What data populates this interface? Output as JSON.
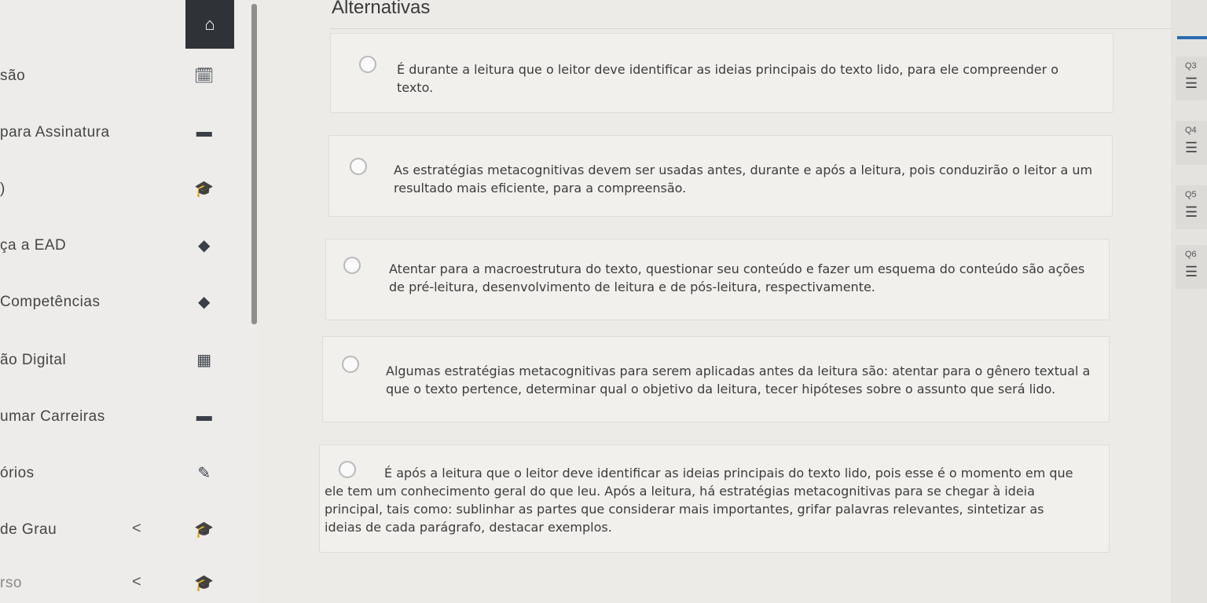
{
  "sidebar": {
    "items": [
      {
        "label": "são",
        "icon": "calendar-check-icon",
        "glyph": "🗓"
      },
      {
        "label": "para Assinatura",
        "icon": "chat-icon",
        "glyph": "▬"
      },
      {
        "label": ")",
        "icon": "graduation-cap-icon",
        "glyph": "🎓"
      },
      {
        "label": "ça a EAD",
        "icon": "diamond-icon",
        "glyph": "◆"
      },
      {
        "label": "Competências",
        "icon": "diamond-icon",
        "glyph": "◆"
      },
      {
        "label": "ão Digital",
        "icon": "calendar-icon",
        "glyph": "▦"
      },
      {
        "label": "umar Carreiras",
        "icon": "briefcase-icon",
        "glyph": "▬"
      },
      {
        "label": "órios",
        "icon": "pencil-icon",
        "glyph": "✎"
      },
      {
        "label": "de Grau",
        "icon": "graduation-cap-icon",
        "glyph": "🎓",
        "chevron": "<"
      },
      {
        "label": "rso",
        "icon": "graduation-cap-icon",
        "glyph": "🎓",
        "chevron": "<"
      }
    ],
    "home_icon": "home-icon",
    "home_glyph": "⌂"
  },
  "main": {
    "section_title": "Alternativas",
    "options": [
      {
        "text": "É durante a leitura que o leitor deve identificar as ideias principais do texto lido, para ele compreender o texto."
      },
      {
        "text": "As estratégias metacognitivas devem ser usadas antes, durante e após a leitura, pois conduzirão o leitor a um resultado mais eficiente, para a compreensão."
      },
      {
        "text": "Atentar para a macroestrutura do texto, questionar seu conteúdo e fazer um esquema do conteúdo são ações de pré-leitura, desenvolvimento de leitura e de pós-leitura, respectivamente."
      },
      {
        "text": "Algumas estratégias metacognitivas para serem aplicadas antes da leitura são: atentar para o gênero textual a que o texto pertence, determinar qual o objetivo da leitura, tecer hipóteses sobre o assunto que será lido."
      },
      {
        "text": "É após a leitura que o leitor deve identificar as ideias principais do texto lido, pois esse é o momento em que ele tem um conhecimento geral do que leu. Após a leitura, há estratégias metacognitivas para se chegar à ideia principal, tais como: sublinhar as partes que considerar mais importantes, grifar palavras relevantes, sintetizar as ideias de cada parágrafo, destacar exemplos."
      }
    ]
  },
  "right_rail": {
    "cards": [
      {
        "q": "Q3",
        "icon": "list-icon",
        "glyph": "☰"
      },
      {
        "q": "Q4",
        "icon": "list-icon",
        "glyph": "☰"
      },
      {
        "q": "Q5",
        "icon": "list-icon",
        "glyph": "☰"
      },
      {
        "q": "Q6",
        "icon": "list-icon",
        "glyph": "☰"
      }
    ]
  }
}
